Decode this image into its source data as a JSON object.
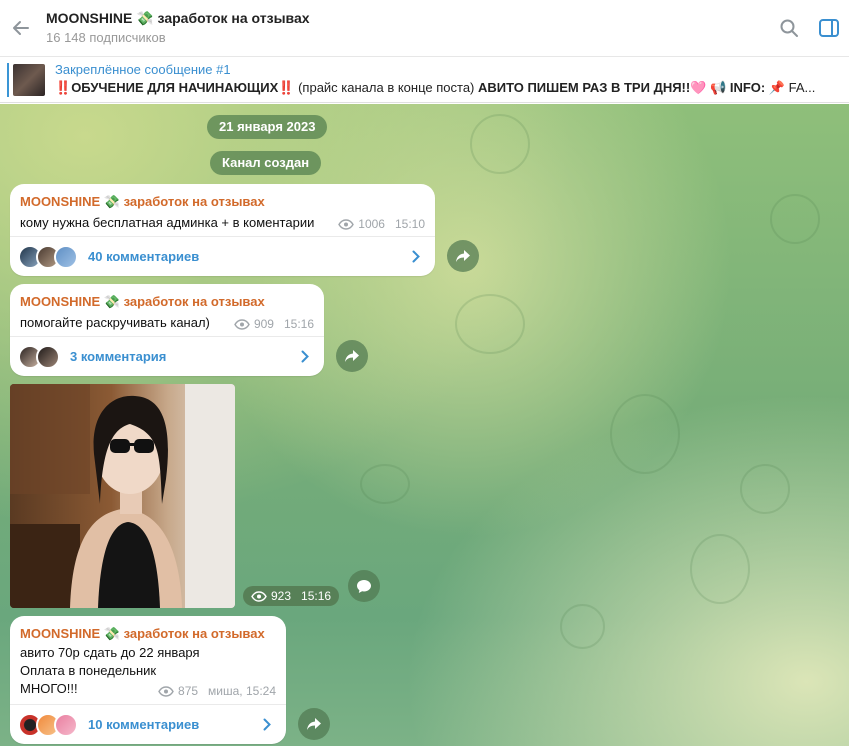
{
  "header": {
    "title": "MOONSHINE 💸 заработок на отзывах",
    "subscribers": "16 148 подписчиков",
    "icons": [
      "arrow-left-icon",
      "search-icon",
      "sidebar-toggle-icon"
    ]
  },
  "pinned": {
    "title": "Закреплённое сообщение #1",
    "mark": "‼️",
    "bold1": "ОБУЧЕНИЕ ДЛЯ НАЧИНАЮЩИХ",
    "mark2": "‼️",
    "plain": "(прайс канала в конце поста)",
    "bold2": "АВИТО ПИШЕМ РАЗ В ТРИ ДНЯ!!",
    "heart": "🩷",
    "info": "📢 INFO:",
    "fa": "📌 FA..."
  },
  "chat": {
    "date_pill": "21 января 2023",
    "service_pill": "Канал создан",
    "messages": [
      {
        "author": "MOONSHINE 💸 заработок на отзывах",
        "text": "кому нужна бесплатная админка + в коментарии",
        "views": "1006",
        "time": "15:10",
        "comments": "40 комментариев"
      },
      {
        "author": "MOONSHINE 💸 заработок на отзывах",
        "text": "помогайте раскручивать канал)",
        "views": "909",
        "time": "15:16",
        "comments": "3 комментария"
      },
      {
        "views": "923",
        "time": "15:16"
      },
      {
        "author": "MOONSHINE 💸 заработок на отзывах",
        "line1": "авито 70р сдать до 22 января",
        "line2": "Оплата в понедельник",
        "line3": "МНОГО!!!",
        "views": "875",
        "signature_time": "миша, 15:24",
        "comments": "10 комментариев"
      }
    ]
  },
  "colors": {
    "accent": "#3a8fd0",
    "author": "#d26a2b",
    "alert": "#d5282c"
  }
}
